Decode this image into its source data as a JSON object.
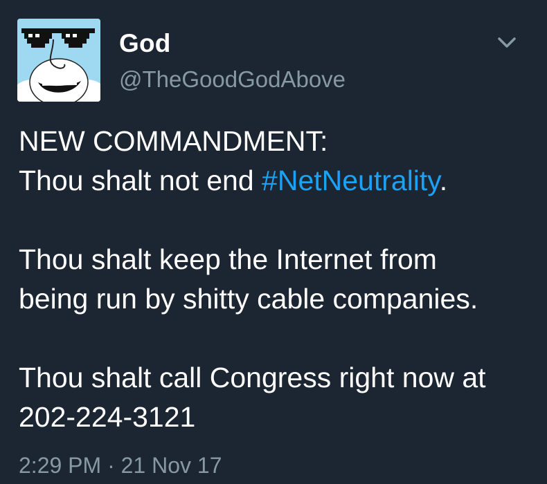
{
  "author": {
    "display_name": "God",
    "handle": "@TheGoodGodAbove",
    "avatar_icon": "cartoon-god-with-pixel-sunglasses-avatar"
  },
  "menu": {
    "icon": "chevron-down-icon"
  },
  "tweet": {
    "line1": "NEW COMMANDMENT:",
    "line2_prefix": "Thou shalt not end ",
    "line2_hashtag": "#NetNeutrality",
    "line2_suffix": ".",
    "line3": "Thou shalt keep the Internet from",
    "line4": "being run by shitty cable companies.",
    "line5": "Thou shalt call Congress right now at",
    "line6": "202-224-3121"
  },
  "timestamp": "2:29 PM · 21 Nov 17",
  "colors": {
    "background": "#1c2532",
    "text": "#ffffff",
    "secondary_text": "#8899a6",
    "link": "#1da1f2",
    "avatar_background": "#9fd9f1"
  }
}
